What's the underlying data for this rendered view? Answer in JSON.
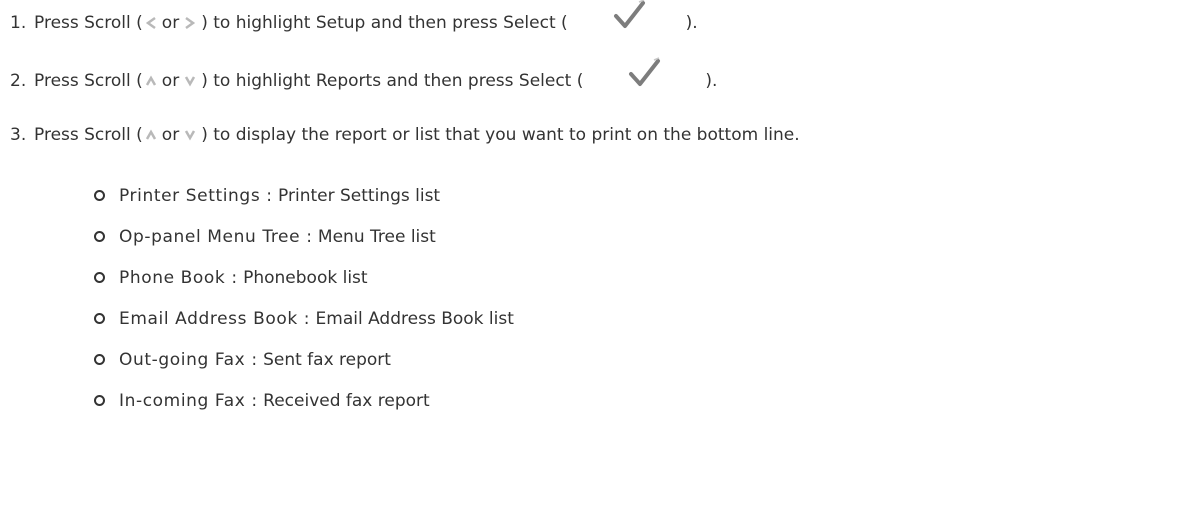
{
  "steps": [
    {
      "number": "1.",
      "text_a": "Press Scroll (",
      "icon_1": "left-arrow-icon",
      "or": "or",
      "icon_2": "right-arrow-icon",
      "text_b": ") to highlight Setup and then press Select (",
      "check": "checkmark-icon",
      "text_c": ")."
    },
    {
      "number": "2.",
      "text_a": "Press Scroll (",
      "icon_1": "up-arrow-icon",
      "or": "or",
      "icon_2": "down-arrow-icon",
      "text_b": ") to highlight Reports and then press Select (",
      "check": "checkmark-icon",
      "text_c": ")."
    },
    {
      "number": "3.",
      "text_a": "Press Scroll (",
      "icon_1": "up-arrow-icon",
      "or": "or",
      "icon_2": "down-arrow-icon",
      "text_b": ") to display the report or list that you want to print on the bottom line."
    }
  ],
  "sub_items": [
    {
      "name": "Printer Settings",
      "sep": ":",
      "desc": "Printer Settings list"
    },
    {
      "name": "Op-panel Menu Tree",
      "sep": ":",
      "desc": "Menu Tree list"
    },
    {
      "name": "Phone Book",
      "sep": ":",
      "desc": "Phonebook list"
    },
    {
      "name": "Email Address Book",
      "sep": ":",
      "desc": "Email Address Book list"
    },
    {
      "name": "Out-going Fax",
      "sep": ":",
      "desc": "Sent fax report"
    },
    {
      "name": "In-coming Fax",
      "sep": ":",
      "desc": "Received fax report"
    }
  ],
  "colors": {
    "text": "#333333",
    "arrow_icon": "#bbbbbb",
    "check_icon": "#777777"
  }
}
